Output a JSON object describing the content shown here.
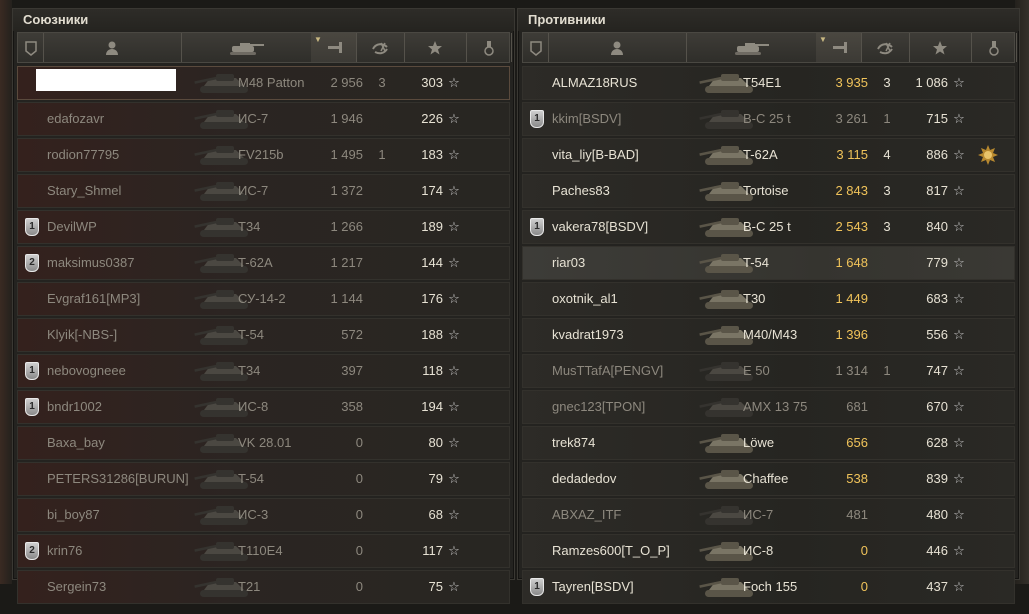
{
  "allies": {
    "title": "Союзники",
    "rows": [
      {
        "name": "",
        "redacted": true,
        "tank": "M48 Patton",
        "damage": "2 956",
        "kills": "3",
        "xp": "303",
        "alive": false,
        "highlight": true,
        "badge": ""
      },
      {
        "name": "edafozavr",
        "tank": "ИС-7",
        "damage": "1 946",
        "kills": "",
        "xp": "226",
        "alive": false,
        "badge": ""
      },
      {
        "name": "rodion77795",
        "tank": "FV215b",
        "damage": "1 495",
        "kills": "1",
        "xp": "183",
        "alive": false,
        "badge": ""
      },
      {
        "name": "Stary_Shmel",
        "tank": "ИС-7",
        "damage": "1 372",
        "kills": "",
        "xp": "174",
        "alive": false,
        "badge": ""
      },
      {
        "name": "DevilWP",
        "tank": "T34",
        "damage": "1 266",
        "kills": "",
        "xp": "189",
        "alive": false,
        "badge": "1"
      },
      {
        "name": "maksimus0387",
        "tank": "T-62A",
        "damage": "1 217",
        "kills": "",
        "xp": "144",
        "alive": false,
        "badge": "2"
      },
      {
        "name": "Evgraf161[MP3]",
        "tank": "СУ-14-2",
        "damage": "1 144",
        "kills": "",
        "xp": "176",
        "alive": false,
        "badge": ""
      },
      {
        "name": "Klyik[-NBS-]",
        "tank": "T-54",
        "damage": "572",
        "kills": "",
        "xp": "188",
        "alive": false,
        "badge": ""
      },
      {
        "name": "nebovogneee",
        "tank": "T34",
        "damage": "397",
        "kills": "",
        "xp": "118",
        "alive": false,
        "badge": "1"
      },
      {
        "name": "bndr1002",
        "tank": "ИС-8",
        "damage": "358",
        "kills": "",
        "xp": "194",
        "alive": false,
        "badge": "1"
      },
      {
        "name": "Baxa_bay",
        "tank": "VK 28.01",
        "damage": "0",
        "kills": "",
        "xp": "80",
        "alive": false,
        "badge": ""
      },
      {
        "name": "PETERS31286[BURUN]",
        "tank": "T-54",
        "damage": "0",
        "kills": "",
        "xp": "79",
        "alive": false,
        "badge": ""
      },
      {
        "name": "bi_boy87",
        "tank": "ИС-3",
        "damage": "0",
        "kills": "",
        "xp": "68",
        "alive": false,
        "badge": ""
      },
      {
        "name": "krin76",
        "tank": "T110E4",
        "damage": "0",
        "kills": "",
        "xp": "117",
        "alive": false,
        "badge": "2"
      },
      {
        "name": "Sergein73",
        "tank": "T21",
        "damage": "0",
        "kills": "",
        "xp": "75",
        "alive": false,
        "badge": ""
      }
    ]
  },
  "enemies": {
    "title": "Противники",
    "rows": [
      {
        "name": "ALMAZ18RUS",
        "tank": "T54E1",
        "damage": "3 935",
        "kills": "3",
        "xp": "1 086",
        "alive": true,
        "badge": ""
      },
      {
        "name": "kkim[BSDV]",
        "tank": "B-C 25 t",
        "damage": "3 261",
        "kills": "1",
        "xp": "715",
        "alive": false,
        "badge": "1"
      },
      {
        "name": "vita_liy[B-BAD]",
        "tank": "T-62A",
        "damage": "3 115",
        "kills": "4",
        "xp": "886",
        "alive": true,
        "badge": "",
        "medal": true
      },
      {
        "name": "Paches83",
        "tank": "Tortoise",
        "damage": "2 843",
        "kills": "3",
        "xp": "817",
        "alive": true,
        "badge": ""
      },
      {
        "name": "vakera78[BSDV]",
        "tank": "B-C 25 t",
        "damage": "2 543",
        "kills": "3",
        "xp": "840",
        "alive": true,
        "badge": "1"
      },
      {
        "name": "riar03",
        "tank": "T-54",
        "damage": "1 648",
        "kills": "",
        "xp": "779",
        "alive": true,
        "badge": "",
        "hover": true
      },
      {
        "name": "oxotnik_al1",
        "tank": "T30",
        "damage": "1 449",
        "kills": "",
        "xp": "683",
        "alive": true,
        "badge": ""
      },
      {
        "name": "kvadrat1973",
        "tank": "M40/M43",
        "damage": "1 396",
        "kills": "",
        "xp": "556",
        "alive": true,
        "badge": ""
      },
      {
        "name": "MusTTafA[PENGV]",
        "tank": "E 50",
        "damage": "1 314",
        "kills": "1",
        "xp": "747",
        "alive": false,
        "badge": ""
      },
      {
        "name": "gnec123[TPON]",
        "tank": "AMX 13 75",
        "damage": "681",
        "kills": "",
        "xp": "670",
        "alive": false,
        "badge": ""
      },
      {
        "name": "trek874",
        "tank": "Löwe",
        "damage": "656",
        "kills": "",
        "xp": "628",
        "alive": true,
        "badge": ""
      },
      {
        "name": "dedadedov",
        "tank": "Chaffee",
        "damage": "538",
        "kills": "",
        "xp": "839",
        "alive": true,
        "badge": ""
      },
      {
        "name": "ABXAZ_ITF",
        "tank": "ИС-7",
        "damage": "481",
        "kills": "",
        "xp": "480",
        "alive": false,
        "badge": ""
      },
      {
        "name": "Ramzes600[T_O_P]",
        "tank": "ИС-8",
        "damage": "0",
        "kills": "",
        "xp": "446",
        "alive": true,
        "badge": ""
      },
      {
        "name": "Tayren[BSDV]",
        "tank": "Foch 155",
        "damage": "0",
        "kills": "",
        "xp": "437",
        "alive": true,
        "badge": "1"
      }
    ]
  },
  "columns": [
    "badge-icon",
    "player-icon",
    "tank-icon",
    "damage-icon",
    "kills-icon",
    "xp-icon",
    "medal-icon"
  ],
  "colors": {
    "damage_alive": "#f0c35a",
    "dead_text": "#8d887e",
    "alive_text": "#e7e2d4"
  }
}
